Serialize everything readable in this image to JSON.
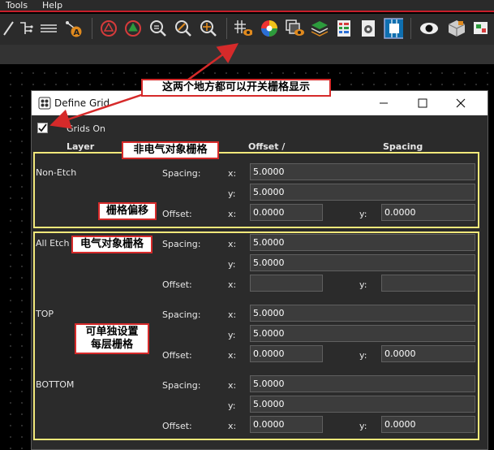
{
  "menu": {
    "items": [
      "Tools",
      "Help"
    ]
  },
  "toolbar": {
    "icons": [
      "line-icon",
      "connect-icon",
      "list-icon",
      "text-a-icon",
      "drc-icon",
      "drc-green-icon",
      "zoom-fit-icon",
      "zoom-in-icon",
      "zoom-target-icon",
      "grid-toggle-icon",
      "color-icon",
      "layers-icon",
      "stack-icon",
      "table-icon",
      "settings-icon",
      "chip-icon",
      "eye-icon",
      "3d-view-icon",
      "extra-icon"
    ]
  },
  "dialog": {
    "title": "Define Grid",
    "grids_on_label": "Grids On",
    "grids_on_checked": true,
    "headers": {
      "layer": "Layer",
      "offset": "Offset  /",
      "spacing": "Spacing"
    },
    "sections": [
      {
        "name": "Non-Etch",
        "spacing_label": "Spacing:",
        "offset_label": "Offset:",
        "x_label": "x:",
        "y_label": "y:",
        "spacing_x": "5.0000",
        "spacing_y": "5.0000",
        "offset_x": "0.0000",
        "offset_y": "0.0000"
      },
      {
        "name": "All Etch",
        "spacing_label": "Spacing:",
        "offset_label": "Offset:",
        "x_label": "x:",
        "y_label": "y:",
        "spacing_x": "5.0000",
        "spacing_y": "5.0000",
        "offset_x": "",
        "offset_y": ""
      },
      {
        "name": "TOP",
        "spacing_label": "Spacing:",
        "offset_label": "Offset:",
        "x_label": "x:",
        "y_label": "y:",
        "spacing_x": "5.0000",
        "spacing_y": "5.0000",
        "offset_x": "0.0000",
        "offset_y": "0.0000"
      },
      {
        "name": "BOTTOM",
        "spacing_label": "Spacing:",
        "offset_label": "Offset:",
        "x_label": "x:",
        "y_label": "y:",
        "spacing_x": "5.0000",
        "spacing_y": "5.0000",
        "offset_x": "0.0000",
        "offset_y": "0.0000"
      }
    ]
  },
  "annotations": {
    "toggle_note": "这两个地方都可以开关栅格显示",
    "non_elec": "非电气对象栅格",
    "offset": "栅格偏移",
    "elec": "电气对象栅格",
    "per_layer_1": "可单独设置",
    "per_layer_2": "每层栅格"
  },
  "colors": {
    "accent_red": "#d62a2a",
    "highlight_yellow": "#f2e87a",
    "menu_border": "#c81e2a"
  }
}
